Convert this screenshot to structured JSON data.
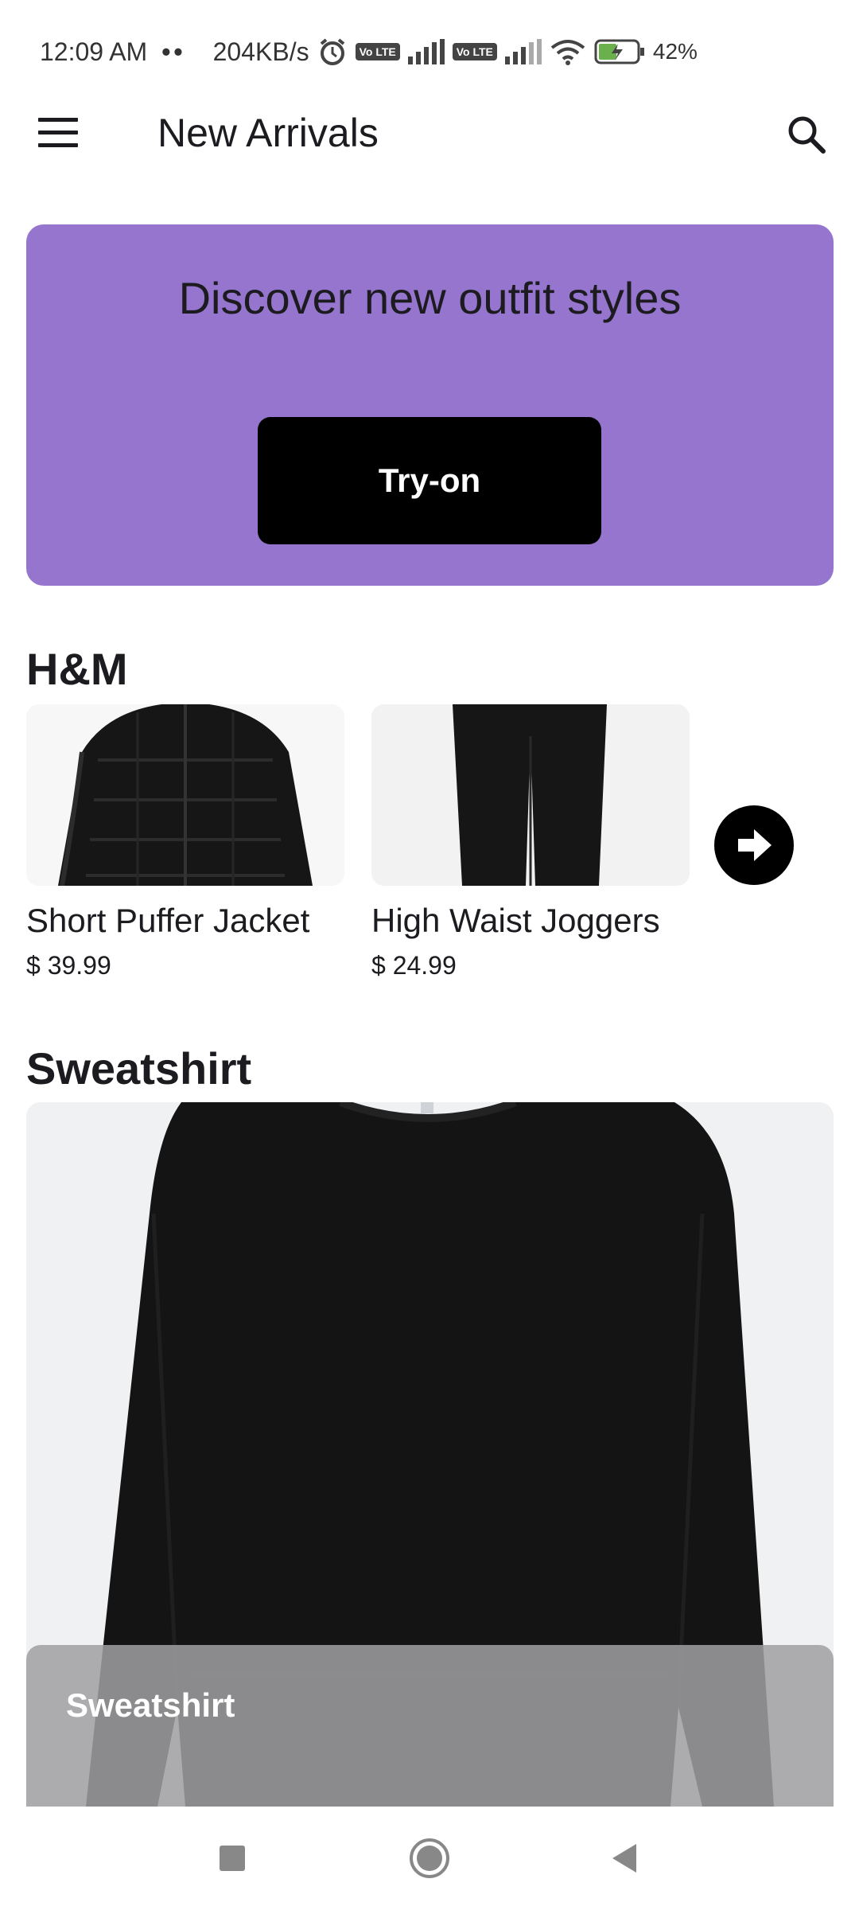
{
  "status_bar": {
    "time": "12:09 AM",
    "dots": "••",
    "speed": "204KB/s",
    "lte1": "Vo LTE",
    "lte2": "Vo LTE",
    "battery": "42%"
  },
  "app_bar": {
    "title": "New Arrivals",
    "menu_icon": "hamburger-menu-icon",
    "search_icon": "search-icon"
  },
  "banner": {
    "headline": "Discover new outfit styles",
    "button_label": "Try-on",
    "background": "#9575cd"
  },
  "brand_section": {
    "title": "H&M",
    "products": [
      {
        "name": "Short Puffer Jacket",
        "price": "$ 39.99"
      },
      {
        "name": "High Waist Joggers",
        "price": "$ 24.99"
      }
    ],
    "next_icon": "arrow-right-circle-icon"
  },
  "feature_section": {
    "title": "Sweatshirt",
    "caption": "Sweatshirt"
  },
  "nav_bar": {
    "recents_icon": "square-icon",
    "home_icon": "circle-icon",
    "back_icon": "triangle-back-icon"
  }
}
